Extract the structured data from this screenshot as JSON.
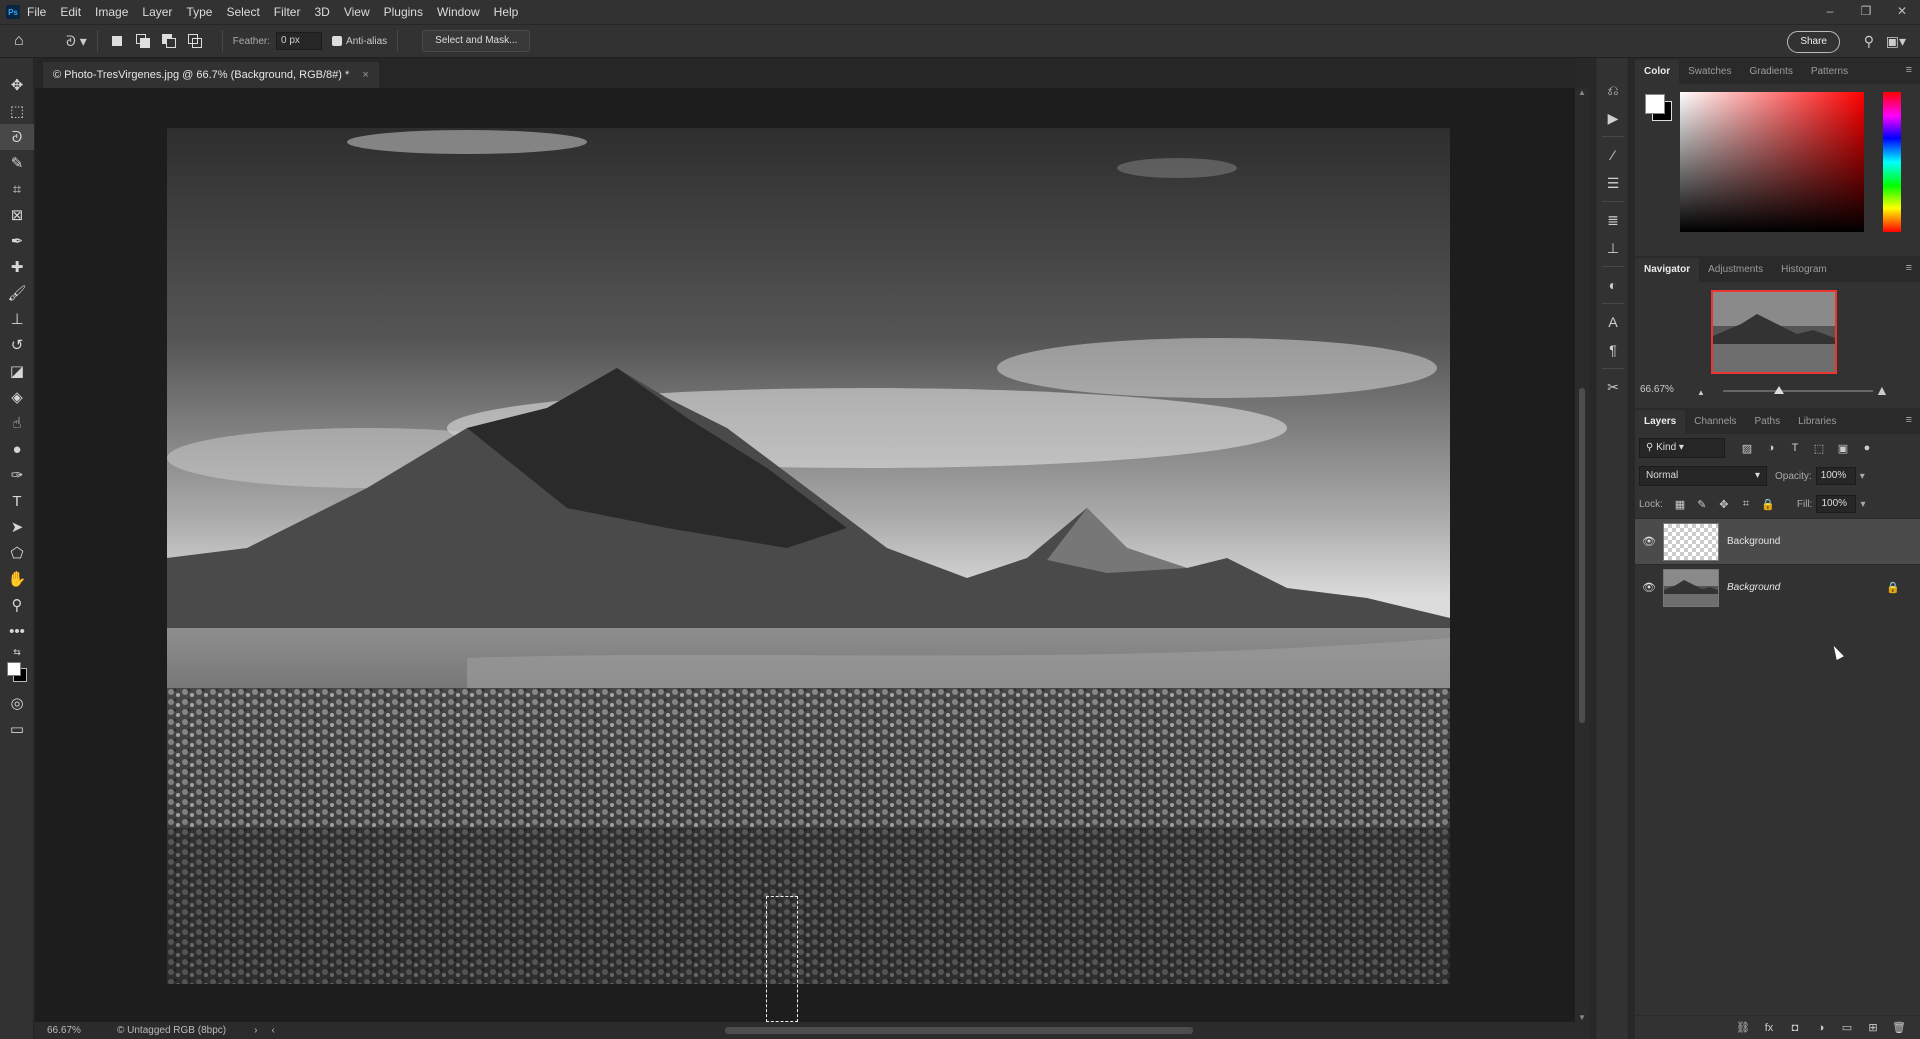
{
  "menubar": {
    "logo": "Ps",
    "items": [
      "File",
      "Edit",
      "Image",
      "Layer",
      "Type",
      "Select",
      "Filter",
      "3D",
      "View",
      "Plugins",
      "Window",
      "Help"
    ],
    "window_controls": [
      "–",
      "❐",
      "✕"
    ]
  },
  "options": {
    "feather_label": "Feather:",
    "feather_value": "0 px",
    "antialias_label": "Anti-alias",
    "antialias_checked": true,
    "select_mask_label": "Select and Mask...",
    "share_label": "Share"
  },
  "toolbar": {
    "tools": [
      {
        "name": "move-tool-icon",
        "glyph": "✥"
      },
      {
        "name": "marquee-tool-icon",
        "glyph": "⬚"
      },
      {
        "name": "lasso-tool-icon",
        "glyph": "ᘑ",
        "active": true
      },
      {
        "name": "quick-select-tool-icon",
        "glyph": "✎"
      },
      {
        "name": "crop-tool-icon",
        "glyph": "⌗"
      },
      {
        "name": "frame-tool-icon",
        "glyph": "⊠"
      },
      {
        "name": "eyedropper-tool-icon",
        "glyph": "✒"
      },
      {
        "name": "healing-brush-tool-icon",
        "glyph": "✚"
      },
      {
        "name": "brush-tool-icon",
        "glyph": "🖌"
      },
      {
        "name": "clone-stamp-tool-icon",
        "glyph": "⊥"
      },
      {
        "name": "history-brush-tool-icon",
        "glyph": "↺"
      },
      {
        "name": "eraser-tool-icon",
        "glyph": "◪"
      },
      {
        "name": "paint-bucket-tool-icon",
        "glyph": "◈"
      },
      {
        "name": "smudge-tool-icon",
        "glyph": "☝"
      },
      {
        "name": "dodge-tool-icon",
        "glyph": "●"
      },
      {
        "name": "pen-tool-icon",
        "glyph": "✑"
      },
      {
        "name": "type-tool-icon",
        "glyph": "T"
      },
      {
        "name": "path-select-tool-icon",
        "glyph": "➤"
      },
      {
        "name": "shape-tool-icon",
        "glyph": "⬠"
      },
      {
        "name": "hand-tool-icon",
        "glyph": "✋"
      },
      {
        "name": "zoom-tool-icon",
        "glyph": "⚲"
      },
      {
        "name": "more-tools-icon",
        "glyph": "•••"
      }
    ]
  },
  "document": {
    "tab_title": "© Photo-TresVirgenes.jpg @ 66.7% (Background, RGB/8#) *",
    "close_glyph": "×"
  },
  "status": {
    "zoom": "66.67%",
    "doc_info": "© Untagged RGB (8bpc)",
    "arrow_right": "›",
    "arrow_left": "‹"
  },
  "color_panel": {
    "tabs": [
      "Color",
      "Swatches",
      "Gradients",
      "Patterns"
    ],
    "foreground": "#ffffff",
    "background": "#000000"
  },
  "navigator_panel": {
    "tabs": [
      "Navigator",
      "Adjustments",
      "Histogram"
    ],
    "zoom": "66.67%",
    "zoom_slider_fraction": 0.37
  },
  "layers_panel": {
    "tabs": [
      "Layers",
      "Channels",
      "Paths",
      "Libraries"
    ],
    "filter_kind": "Kind",
    "blend_mode": "Normal",
    "opacity_label": "Opacity:",
    "opacity_value": "100%",
    "lock_label": "Lock:",
    "fill_label": "Fill:",
    "fill_value": "100%",
    "layers": [
      {
        "name": "Background",
        "selected": true,
        "italic": false,
        "locked": false,
        "thumb": "transparent"
      },
      {
        "name": "Background",
        "selected": false,
        "italic": true,
        "locked": true,
        "thumb": "photo"
      }
    ]
  },
  "panel_menu_glyph": "≡"
}
